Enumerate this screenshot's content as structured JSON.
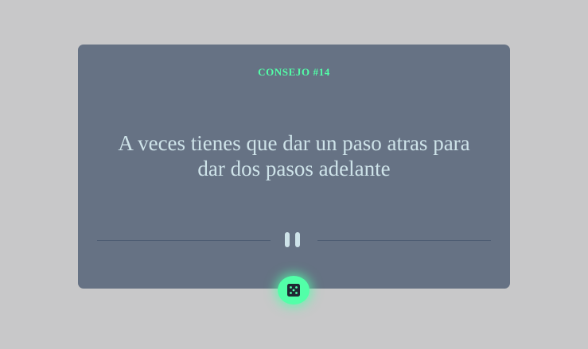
{
  "advice": {
    "id_label": "CONSEJO #14",
    "text": "A veces tienes que dar un paso atras para dar dos pasos adelante"
  },
  "colors": {
    "page_background": "#c8c8c9",
    "card_background": "#667284",
    "accent": "#52ffa8",
    "text": "#cee3e9",
    "divider": "#4e5d73",
    "dice_face": "#202733"
  },
  "icons": {
    "divider": "pause-icon",
    "button": "dice-icon"
  }
}
